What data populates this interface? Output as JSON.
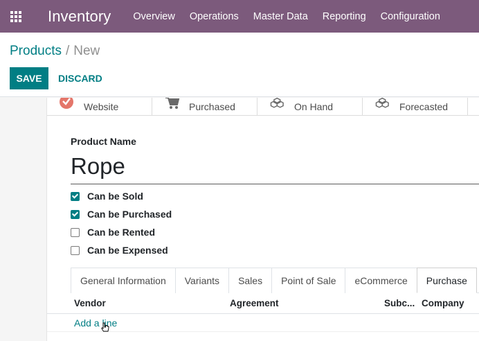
{
  "navbar": {
    "app_title": "Inventory",
    "menu": [
      "Overview",
      "Operations",
      "Master Data",
      "Reporting",
      "Configuration"
    ],
    "color": "#7c5a7c"
  },
  "breadcrumb": {
    "parent": "Products",
    "separator": "/",
    "current": "New"
  },
  "actions": {
    "save": "SAVE",
    "discard": "DISCARD",
    "accent": "#017e84"
  },
  "smart_buttons": [
    {
      "label": "Website",
      "icon": "globe-icon"
    },
    {
      "label": "Purchased",
      "icon": "cart-icon"
    },
    {
      "label": "On Hand",
      "icon": "cubes-icon"
    },
    {
      "label": "Forecasted",
      "icon": "cubes-icon"
    }
  ],
  "form": {
    "name_label": "Product Name",
    "name_value": "Rope",
    "options": [
      {
        "label": "Can be Sold",
        "checked": true
      },
      {
        "label": "Can be Purchased",
        "checked": true
      },
      {
        "label": "Can be Rented",
        "checked": false
      },
      {
        "label": "Can be Expensed",
        "checked": false
      }
    ]
  },
  "tabs": [
    {
      "label": "General Information",
      "active": false
    },
    {
      "label": "Variants",
      "active": false
    },
    {
      "label": "Sales",
      "active": false
    },
    {
      "label": "Point of Sale",
      "active": false
    },
    {
      "label": "eCommerce",
      "active": false
    },
    {
      "label": "Purchase",
      "active": true
    }
  ],
  "vendor_table": {
    "columns": [
      "Vendor",
      "Agreement",
      "Subc...",
      "Company"
    ],
    "add_line": "Add a line"
  }
}
